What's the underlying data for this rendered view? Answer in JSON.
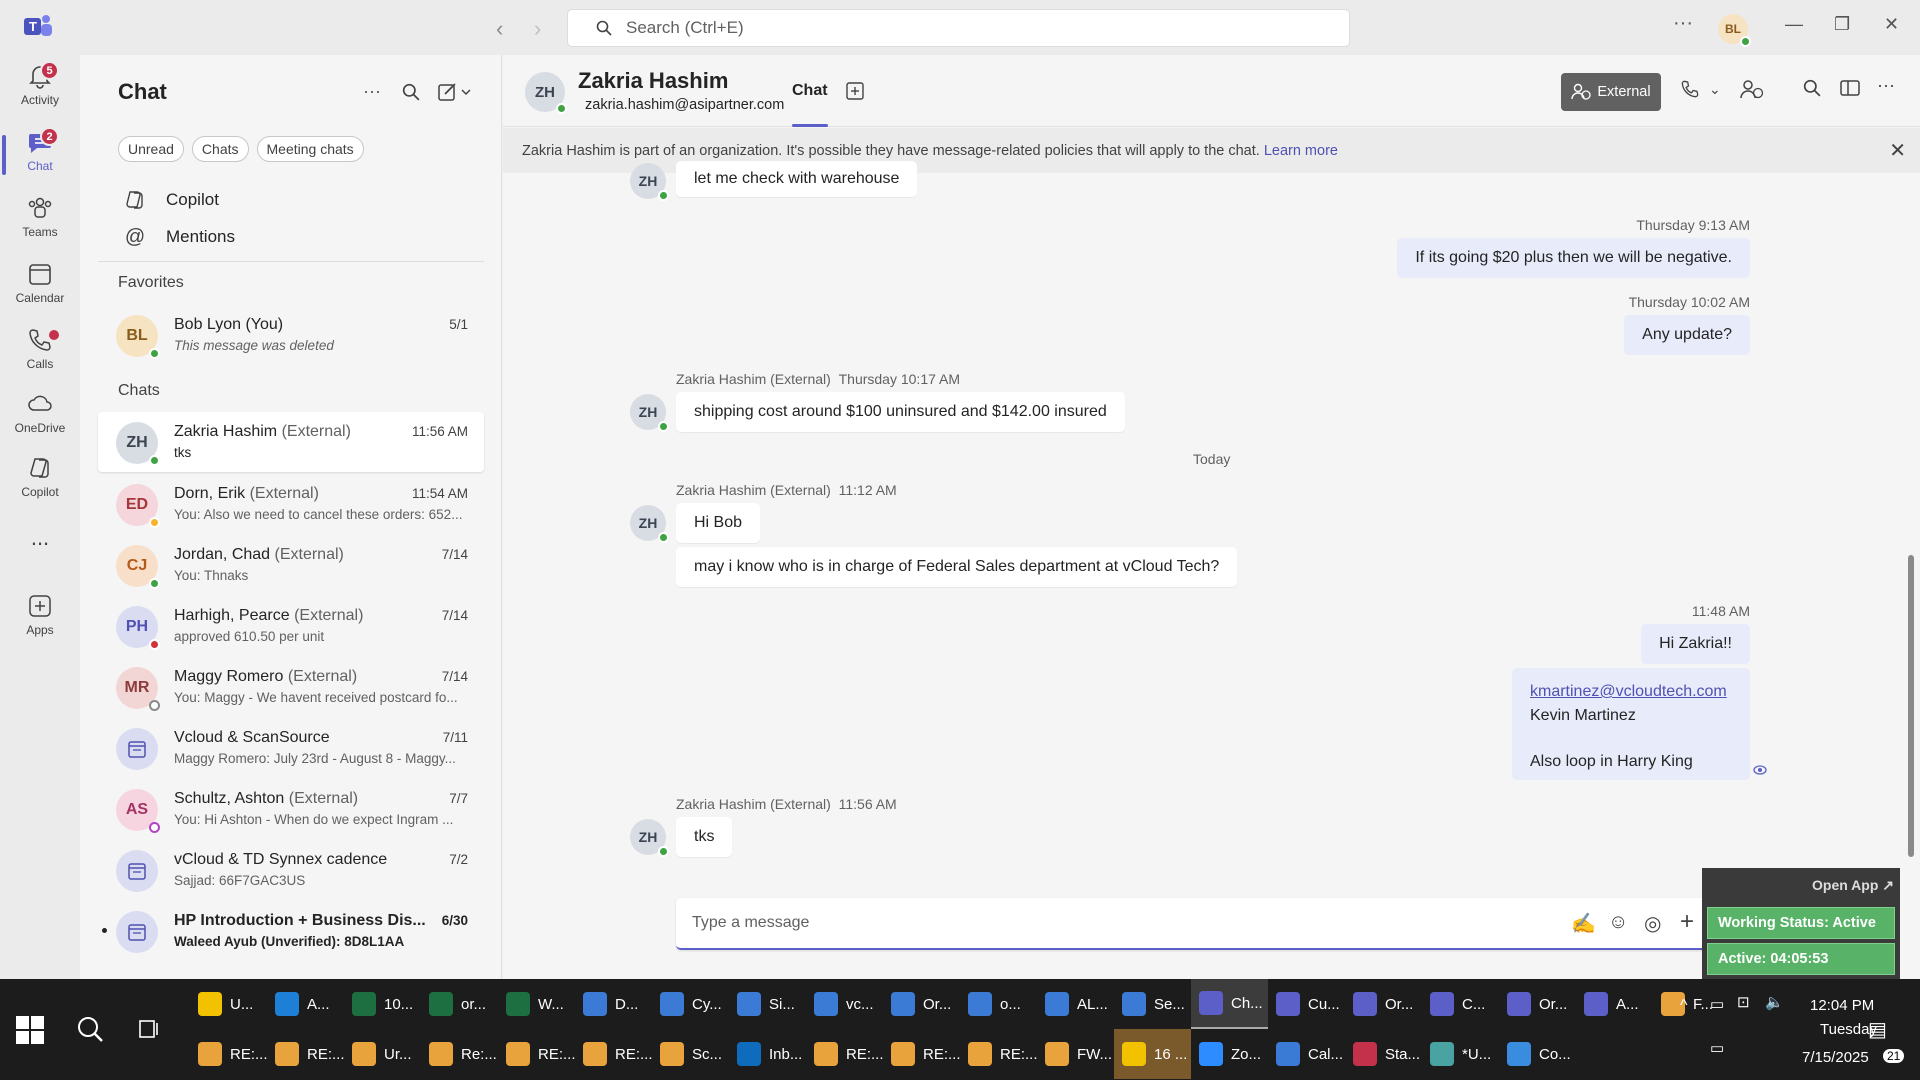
{
  "titlebar": {
    "search_placeholder": "Search (Ctrl+E)",
    "user_initials": "BL"
  },
  "rail": {
    "items": [
      {
        "label": "Activity",
        "badge": "5"
      },
      {
        "label": "Chat",
        "badge": "2"
      },
      {
        "label": "Teams"
      },
      {
        "label": "Calendar"
      },
      {
        "label": "Calls"
      },
      {
        "label": "OneDrive"
      },
      {
        "label": "Copilot"
      },
      {
        "label": "..."
      },
      {
        "label": "Apps"
      }
    ]
  },
  "list": {
    "title": "Chat",
    "filters": [
      "Unread",
      "Chats",
      "Meeting chats"
    ],
    "nav": [
      "Copilot",
      "Mentions"
    ],
    "favorites_label": "Favorites",
    "chats_label": "Chats",
    "favorites": [
      {
        "initials": "BL",
        "name": "Bob Lyon (You)",
        "ext": "",
        "preview": "This message was deleted",
        "time": "5/1"
      }
    ],
    "chats": [
      {
        "initials": "ZH",
        "name": "Zakria Hashim",
        "ext": " (External)",
        "preview": "tks",
        "time": "11:56 AM"
      },
      {
        "initials": "ED",
        "name": "Dorn, Erik",
        "ext": " (External)",
        "preview": "You: Also we need to cancel these orders: 652...",
        "time": "11:54 AM"
      },
      {
        "initials": "CJ",
        "name": "Jordan, Chad",
        "ext": " (External)",
        "preview": "You: Thnaks",
        "time": "7/14"
      },
      {
        "initials": "PH",
        "name": "Harhigh, Pearce",
        "ext": " (External)",
        "preview": "approved 610.50 per unit",
        "time": "7/14"
      },
      {
        "initials": "MR",
        "name": "Maggy Romero",
        "ext": " (External)",
        "preview": "You: Maggy - We havent received postcard fo...",
        "time": "7/14"
      },
      {
        "initials": "",
        "name": "Vcloud & ScanSource",
        "ext": "",
        "preview": "Maggy Romero: July 23rd - August 8 - Maggy...",
        "time": "7/11"
      },
      {
        "initials": "AS",
        "name": "Schultz, Ashton",
        "ext": " (External)",
        "preview": "You: Hi Ashton -  When do we expect Ingram ...",
        "time": "7/7"
      },
      {
        "initials": "",
        "name": "vCloud & TD Synnex cadence",
        "ext": "",
        "preview": "Sajjad: 66F7GAC3US",
        "time": "7/2"
      },
      {
        "initials": "",
        "name": "HP Introduction + Business Dis...",
        "ext": "",
        "preview": "Waleed Ayub (Unverified): 8D8L1AA",
        "time": "6/30"
      }
    ]
  },
  "header": {
    "initials": "ZH",
    "name": "Zakria Hashim",
    "email": "zakria.hashim@asipartner.com",
    "tab": "Chat",
    "external_label": "External"
  },
  "banner": {
    "text": "Zakria Hashim is part of an organization. It's possible they have message-related policies that will apply to the chat.",
    "link": "Learn more"
  },
  "messages": {
    "m1": "let me check with warehouse",
    "t2": "Thursday 9:13 AM",
    "m2": "If its going $20 plus then we will be negative.",
    "t3": "Thursday 10:02 AM",
    "m3": "Any update?",
    "s4": "Zakria Hashim (External)",
    "t4": "Thursday 10:17 AM",
    "m4": "shipping cost around $100 uninsured and $142.00 insured",
    "today": "Today",
    "s5": "Zakria Hashim (External)",
    "t5": "11:12 AM",
    "m5a": "Hi Bob",
    "m5b": "may i know who is in charge of Federal Sales department at vCloud Tech?",
    "t6": "11:48 AM",
    "m6a": "Hi Zakria!!",
    "m6b_link": "kmartinez@vcloudtech.com",
    "m6b_line2": "Kevin Martinez",
    "m6b_line3": "Also loop in Harry King",
    "s7": "Zakria Hashim (External)",
    "t7": "11:56 AM",
    "m7": "tks"
  },
  "compose": {
    "placeholder": "Type a message"
  },
  "widget": {
    "open_app": "Open App ↗",
    "status": "Working Status: Active",
    "active": "Active: 04:05:53"
  },
  "taskbar": {
    "row1": [
      "U...",
      "A...",
      "10...",
      "or...",
      "W...",
      "D...",
      "Cy...",
      "Si...",
      "vc...",
      "Or...",
      "o...",
      "AL...",
      "Se...",
      "Ch...",
      "Cu...",
      "Or...",
      "C...",
      "Or...",
      "A...",
      "F..."
    ],
    "row2": [
      "RE:...",
      "RE:...",
      "Ur...",
      "Re:...",
      "RE:...",
      "RE:...",
      "Sc...",
      "Inb...",
      "RE:...",
      "RE:...",
      "RE:...",
      "FW...",
      "16 ...",
      "Zo...",
      "Cal...",
      "Sta...",
      "*U...",
      "Co..."
    ],
    "time": "12:04 PM",
    "day": "Tuesday",
    "date": "7/15/2025",
    "notif": "21"
  },
  "colors": {
    "accent": "#5b5fc7",
    "presence": "#3fa343",
    "badge": "#c4314b"
  }
}
